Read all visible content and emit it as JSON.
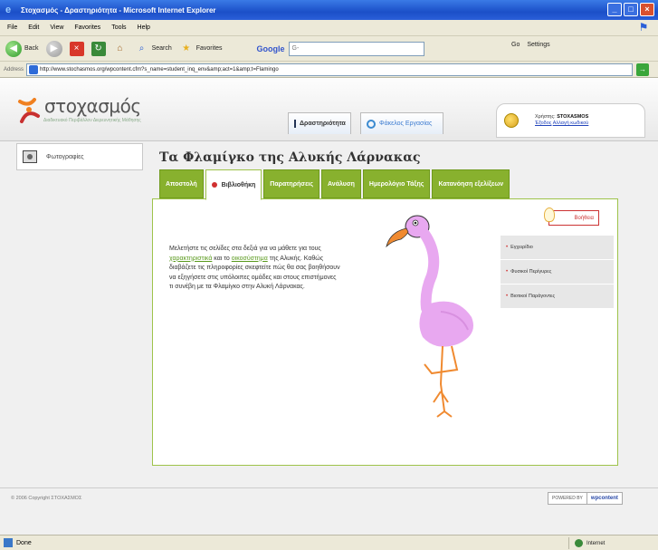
{
  "window": {
    "title": "Στοχασμός - Δραστηριότητα - Microsoft Internet Explorer",
    "controls": [
      "_",
      "□",
      "×"
    ]
  },
  "menu": [
    "File",
    "Edit",
    "View",
    "Favorites",
    "Tools",
    "Help"
  ],
  "toolbar": {
    "back": "Back",
    "search": "Search",
    "favorites": "Favorites",
    "google_label": "Google",
    "google_placeholder": "G-",
    "go": "Go",
    "settings": "Settings"
  },
  "address": {
    "label": "Address",
    "url": "http://www.stochasmos.org/wpcontent.cfm?s_name=student_inq_env&amp;act=1&amp;t=Flamingo"
  },
  "site": {
    "logo_text": "στοχασμός",
    "logo_sub": "Διαδικτυακό Περιβάλλον Διερευνητικής Μάθησης",
    "nav_home": "Δραστηριότητα",
    "nav_tools": "Φάκελος Εργασίας",
    "user_label": "Χρήστης:",
    "user_name": "STOXASMOS",
    "user_link1": "Έξοδος",
    "user_link2": "Αλλαγή κωδικού"
  },
  "sidebar": {
    "item": "Φωτογραφίες"
  },
  "main": {
    "title": "Τα Φλαμίγκο της Αλυκής Λάρνακας",
    "tabs": [
      "Αποστολή",
      "Βιβλιοθήκη",
      "Παρατηρήσεις",
      "Ανάλυση",
      "Ημερολόγιο Τάξης",
      "Κατανόηση εξελίξεων"
    ],
    "active_tab": 1,
    "help": "Βοήθεια",
    "body": {
      "p1": "Μελετήστε τις σελίδες στα δεξιά για να μάθετε για τους ",
      "link1": "χαρακτηριστικά",
      "p2": " και το ",
      "link2": "οικοσύστημα",
      "p3": " της Αλυκής. Καθώς διαβάζετε τις πληροφορίες σκεφτείτε πώς θα σας βοηθήσουν να εξηγήσετε στις υπόλοιπες ομάδες και στους επιστήμονες τι συνέβη με τα Φλαμίγκο στην Αλυκή Λάρνακας."
    },
    "sublist": [
      "Εγχειρίδιο",
      "Φυσικοί Περίγυρες",
      "Βιοτικοί Παράγοντες"
    ]
  },
  "footer": {
    "copyright": "© 2006 Copyright ΣΤΟΧΑΣΜΟΣ",
    "powered": "POWERED BY",
    "brand": "wpcontent"
  },
  "status": {
    "left": "Done",
    "zone": "Internet"
  },
  "colors": {
    "tab_green": "#88b12e",
    "accent_red": "#d03030",
    "link_green": "#5a9a1e",
    "flamingo_pink": "#e8a8f0",
    "beak_orange": "#f08a30"
  }
}
